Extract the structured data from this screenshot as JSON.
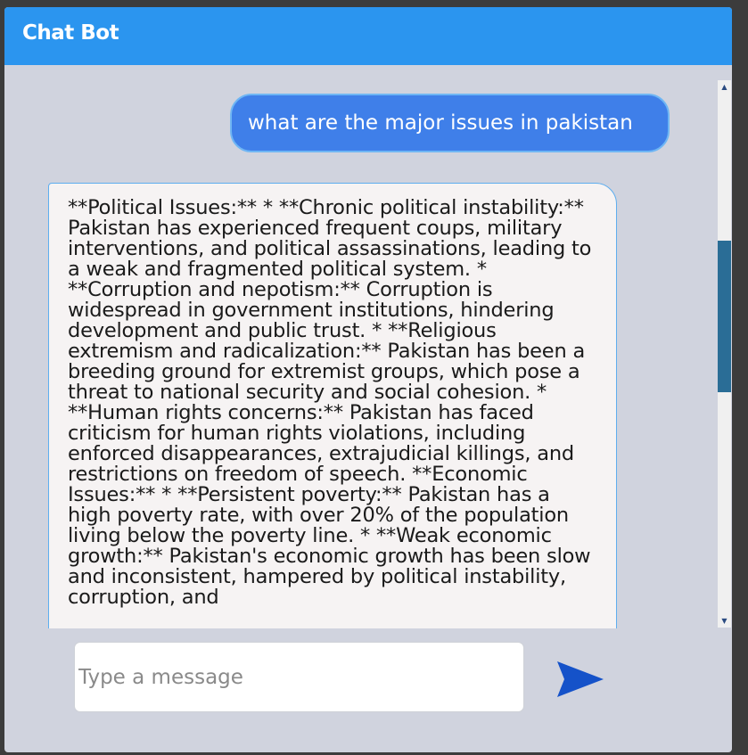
{
  "header": {
    "title": "Chat Bot"
  },
  "messages": {
    "user": "what are the major issues in pakistan",
    "bot": "**Political Issues:** * **Chronic political instability:** Pakistan has experienced frequent coups, military interventions, and political assassinations, leading to a weak and fragmented political system. * **Corruption and nepotism:** Corruption is widespread in government institutions, hindering development and public trust. * **Religious extremism and radicalization:** Pakistan has been a breeding ground for extremist groups, which pose a threat to national security and social cohesion. * **Human rights concerns:** Pakistan has faced criticism for human rights violations, including enforced disappearances, extrajudicial killings, and restrictions on freedom of speech. **Economic Issues:** * **Persistent poverty:** Pakistan has a high poverty rate, with over 20% of the population living below the poverty line. * **Weak economic growth:** Pakistan's economic growth has been slow and inconsistent, hampered by political instability, corruption, and"
  },
  "composer": {
    "value": "",
    "placeholder": "Type a message"
  },
  "icons": {
    "send": "send-arrow-icon",
    "scroll_up": "scroll-up-arrow-icon",
    "scroll_down": "scroll-down-arrow-icon"
  },
  "colors": {
    "header": "#2b95ef",
    "user_bubble": "#3f7fe9",
    "bot_bubble": "#f6f3f3",
    "background": "#d0d3de",
    "send_icon": "#1552c9",
    "scroll_thumb": "#2a6d96"
  }
}
